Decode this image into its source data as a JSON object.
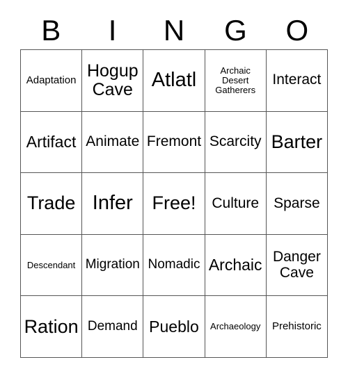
{
  "header": {
    "letters": [
      "B",
      "I",
      "N",
      "G",
      "O"
    ]
  },
  "grid": {
    "rows": 5,
    "columns": 5,
    "border_color": "#555555",
    "background_color": "#ffffff",
    "text_color": "#000000",
    "cells": [
      {
        "text": "Adaptation",
        "size": "fs-s"
      },
      {
        "text": "Hogup\nCave",
        "size": "fs-xl"
      },
      {
        "text": "Atlatl",
        "size": "fs-huge"
      },
      {
        "text": "Archaic\nDesert\nGatherers",
        "size": "fs-xs"
      },
      {
        "text": "Interact",
        "size": "fs-ml"
      },
      {
        "text": "Artifact",
        "size": "fs-l"
      },
      {
        "text": "Animate",
        "size": "fs-ml"
      },
      {
        "text": "Fremont",
        "size": "fs-ml"
      },
      {
        "text": "Scarcity",
        "size": "fs-ml"
      },
      {
        "text": "Barter",
        "size": "fs-xxl"
      },
      {
        "text": "Trade",
        "size": "fs-xxl"
      },
      {
        "text": "Infer",
        "size": "fs-huge"
      },
      {
        "text": "Free!",
        "size": "fs-xxl"
      },
      {
        "text": "Culture",
        "size": "fs-ml"
      },
      {
        "text": "Sparse",
        "size": "fs-ml"
      },
      {
        "text": "Descendant",
        "size": "fs-xs"
      },
      {
        "text": "Migration",
        "size": "fs-m"
      },
      {
        "text": "Nomadic",
        "size": "fs-m"
      },
      {
        "text": "Archaic",
        "size": "fs-l"
      },
      {
        "text": "Danger\nCave",
        "size": "fs-ml"
      },
      {
        "text": "Ration",
        "size": "fs-xxl"
      },
      {
        "text": "Demand",
        "size": "fs-m"
      },
      {
        "text": "Pueblo",
        "size": "fs-l"
      },
      {
        "text": "Archaeology",
        "size": "fs-xs"
      },
      {
        "text": "Prehistoric",
        "size": "fs-s"
      }
    ]
  }
}
